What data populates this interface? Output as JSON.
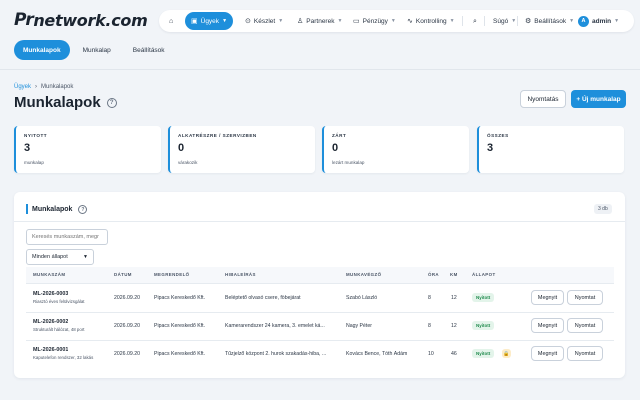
{
  "brand": {
    "logo_mark": "Pr",
    "logo_text": "network.com"
  },
  "nav": {
    "home_icon": "home-icon",
    "items": [
      {
        "label": "Ügyek",
        "icon": "briefcase-icon"
      },
      {
        "label": "Készlet",
        "icon": "box-icon"
      },
      {
        "label": "Partnerek",
        "icon": "users-icon"
      },
      {
        "label": "Pénzügy",
        "icon": "wallet-icon"
      },
      {
        "label": "Kontrolling",
        "icon": "chart-icon"
      }
    ],
    "help_label": "Súgó",
    "settings_label": "Beállítások",
    "avatar_initial": "A",
    "user_label": "admin"
  },
  "subtabs": [
    "Munkalapok",
    "Munkalap",
    "Beállítások"
  ],
  "breadcrumb": {
    "parent": "Ügyek",
    "current": "Munkalapok"
  },
  "page": {
    "title": "Munkalapok",
    "print_label": "Nyomtatás",
    "new_label": "+ Új munkalap"
  },
  "stats": [
    {
      "label": "NYITOTT",
      "value": "3",
      "sub": "munkalap"
    },
    {
      "label": "ALKATRÉSZRE / SZERVIZBEN",
      "value": "0",
      "sub": "várakozik"
    },
    {
      "label": "ZÁRT",
      "value": "0",
      "sub": "lezárt munkalap"
    },
    {
      "label": "ÖSSZES",
      "value": "3",
      "sub": ""
    }
  ],
  "panel": {
    "title": "Munkalapok",
    "count": "3 db",
    "search_placeholder": "Keresés munkaszám, megr",
    "filter_value": "Minden állapot"
  },
  "table": {
    "headers": [
      "MUNKASZÁM",
      "DÁTUM",
      "MEGRENDELŐ",
      "HIBALEÍRÁS",
      "MUNKAVÉGZŐ",
      "ÓRA",
      "KM",
      "ÁLLAPOT"
    ],
    "rows": [
      {
        "id": "ML-2026-0003",
        "desc": "Riasztó éves felülvizsgálat",
        "date": "2026.09.20",
        "customer": "Pipacs Kereskedő Kft.",
        "issue": "Beléptető olvasó csere, föbejárat",
        "worker": "Szabó László",
        "hours": "8",
        "km": "12",
        "status": "Nyitott",
        "lock": false,
        "open_label": "Megnyit",
        "print_label": "Nyomtat"
      },
      {
        "id": "ML-2026-0002",
        "desc": "Strukturált hálózat, 48 port",
        "date": "2026.09.20",
        "customer": "Pipacs Kereskedő Kft.",
        "issue": "Kamerarendszer 24 kamera, 3. emelet ká...",
        "worker": "Nagy Péter",
        "hours": "8",
        "km": "12",
        "status": "Nyitott",
        "lock": false,
        "open_label": "Megnyit",
        "print_label": "Nyomtat"
      },
      {
        "id": "ML-2026-0001",
        "desc": "Kaputelefon rendszer, 32 lakás",
        "date": "2026.09.20",
        "customer": "Pipacs Kereskedő Kft.",
        "issue": "Tűzjelző központ 2. hurok szakadás-hiba, ...",
        "worker": "Kovács Bence, Tóth Ádám",
        "hours": "10",
        "km": "46",
        "status": "Nyitott",
        "lock": true,
        "open_label": "Megnyit",
        "print_label": "Nyomtat"
      }
    ]
  },
  "colors": {
    "accent": "#1e8fdb",
    "status_open_bg": "#e3f4ea",
    "status_open_text": "#1f8a4c",
    "background": "#f1f4f8"
  }
}
